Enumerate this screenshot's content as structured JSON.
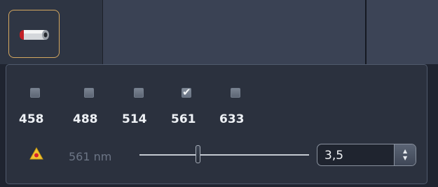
{
  "laser_button": {
    "icon": "laser-tube-icon"
  },
  "wavelengths": [
    {
      "label": "458",
      "checked": false
    },
    {
      "label": "488",
      "checked": false
    },
    {
      "label": "514",
      "checked": false
    },
    {
      "label": "561",
      "checked": true
    },
    {
      "label": "633",
      "checked": false
    }
  ],
  "slider": {
    "warning_icon": "laser-warning-icon",
    "label": "561 nm",
    "value": "3,5"
  },
  "colors": {
    "selected_border": "#d4a760",
    "warning": "#f1c232"
  }
}
